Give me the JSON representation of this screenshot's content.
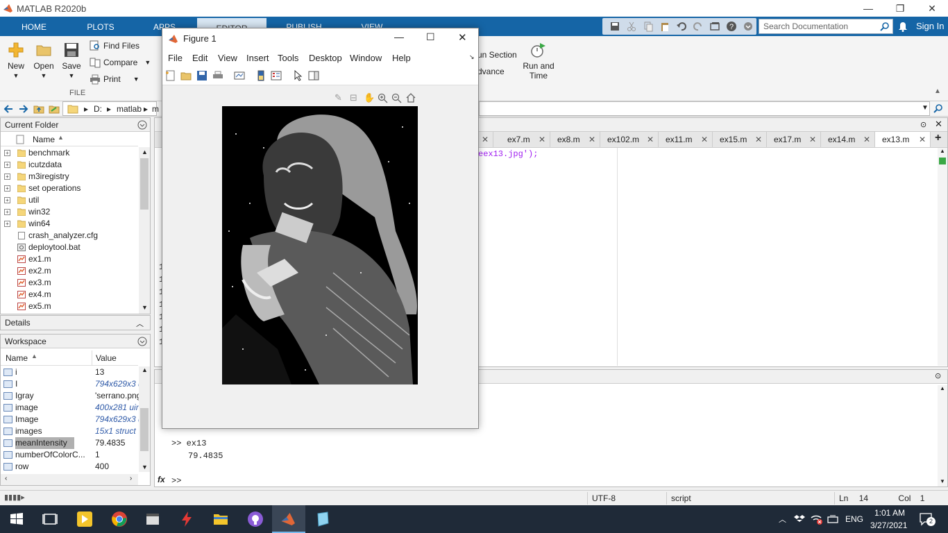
{
  "window": {
    "title": "MATLAB R2020b",
    "minimize": "—",
    "restore": "❐",
    "close": "✕"
  },
  "ribbon_tabs": [
    "HOME",
    "PLOTS",
    "APPS",
    "EDITOR",
    "PUBLISH",
    "VIEW"
  ],
  "search": {
    "placeholder": "Search Documentation"
  },
  "signin": "Sign In",
  "ribbon": {
    "new": "New",
    "open": "Open",
    "save": "Save",
    "find_files": "Find Files",
    "compare": "Compare",
    "print": "Print",
    "group_file": "FILE",
    "run_section": "un Section",
    "advance": "dvance",
    "run_time_1": "Run and",
    "run_time_2": "Time"
  },
  "address": {
    "drive": "D:",
    "folder": "matlab",
    "folder_trunc": "m"
  },
  "current_folder": {
    "title": "Current Folder",
    "col_name": "Name",
    "items": [
      {
        "name": "benchmark",
        "type": "folder"
      },
      {
        "name": "icutzdata",
        "type": "folder"
      },
      {
        "name": "m3iregistry",
        "type": "folder"
      },
      {
        "name": "set operations",
        "type": "folder"
      },
      {
        "name": "util",
        "type": "folder"
      },
      {
        "name": "win32",
        "type": "folder"
      },
      {
        "name": "win64",
        "type": "folder"
      },
      {
        "name": "crash_analyzer.cfg",
        "type": "file"
      },
      {
        "name": "deploytool.bat",
        "type": "bat"
      },
      {
        "name": "ex1.m",
        "type": "m"
      },
      {
        "name": "ex2.m",
        "type": "m"
      },
      {
        "name": "ex3.m",
        "type": "m"
      },
      {
        "name": "ex4.m",
        "type": "m"
      },
      {
        "name": "ex5.m",
        "type": "m"
      }
    ]
  },
  "details": {
    "title": "Details"
  },
  "workspace": {
    "title": "Workspace",
    "col_name": "Name",
    "col_value": "Value",
    "rows": [
      {
        "name": "i",
        "value": "13",
        "italic": false
      },
      {
        "name": "I",
        "value": "794x629x3 u",
        "italic": true
      },
      {
        "name": "Igray",
        "value": "'serrano.png",
        "italic": false
      },
      {
        "name": "image",
        "value": "400x281 uin",
        "italic": true
      },
      {
        "name": "Image",
        "value": "794x629x3 u",
        "italic": true
      },
      {
        "name": "images",
        "value": "15x1 struct",
        "italic": true
      },
      {
        "name": "meanIntensity",
        "value": "79.4835",
        "italic": false
      },
      {
        "name": "numberOfColorC...",
        "value": "1",
        "italic": false
      },
      {
        "name": "row",
        "value": "400",
        "italic": false
      }
    ]
  },
  "editor_tabs": [
    "ex7.m",
    "ex8.m",
    "ex102.m",
    "ex11.m",
    "ex15.m",
    "ex17.m",
    "ex14.m",
    "ex13.m"
  ],
  "editor": {
    "code_fragment": "eex13.jpg');",
    "line_digit": "1"
  },
  "command_window": {
    "prompt_cmd": ">> ex13",
    "output": "79.4835",
    "prompt": ">>",
    "fx": "fx"
  },
  "figure": {
    "title": "Figure 1",
    "menu": [
      "File",
      "Edit",
      "View",
      "Insert",
      "Tools",
      "Desktop",
      "Window",
      "Help"
    ]
  },
  "status": {
    "encoding": "UTF-8",
    "type": "script",
    "ln_label": "Ln",
    "ln": "14",
    "col_label": "Col",
    "col": "1"
  },
  "taskbar": {
    "lang": "ENG",
    "time": "1:01 AM",
    "date": "3/27/2021",
    "notif": "2"
  },
  "colors": {
    "ribbon_blue": "#1565a6",
    "taskbar": "#1f2a38",
    "matlab_orange": "#e16737"
  }
}
